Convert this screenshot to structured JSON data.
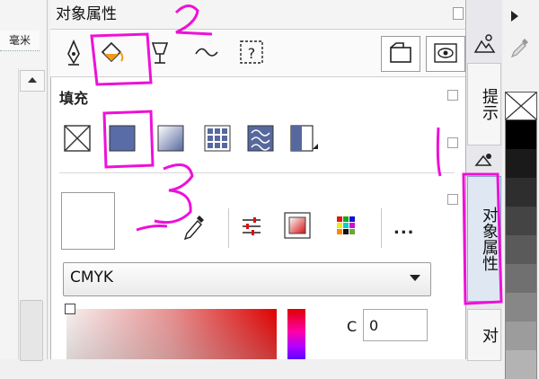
{
  "panel": {
    "title": "对象属性",
    "fill_section_label": "填充",
    "color_model": "CMYK",
    "c_label": "C",
    "c_value": "0",
    "more_label": "..."
  },
  "left": {
    "unit": "毫米"
  },
  "docker_tabs": [
    "提示",
    "对象属性",
    "对"
  ],
  "annotations": {
    "mark2": "2",
    "mark3": "3"
  },
  "colors": {
    "annotation": "#ee10d8",
    "selected_fill": "#5a6ca8",
    "panel_bg": "#ffffff",
    "docker_active": "#dfe7f3"
  },
  "icons": {
    "tabs": [
      "pen-nib-icon",
      "paint-bucket-icon",
      "wine-glass-icon",
      "curve-icon",
      "frame-question-icon"
    ],
    "fill_types": [
      "no-fill-icon",
      "uniform-fill-icon",
      "fountain-fill-icon",
      "pattern-fill-icon",
      "texture-fill-icon",
      "postscript-fill-icon"
    ],
    "tools": [
      "eyedropper-icon",
      "mixer-sliders-icon",
      "color-viewer-icon",
      "palette-grid-icon"
    ]
  },
  "palette": [
    "#000000",
    "#1a1a1a",
    "#2e2e2e",
    "#444444",
    "#5a5a5a",
    "#707070",
    "#878787",
    "#9c9c9c",
    "#b3b3b3"
  ]
}
